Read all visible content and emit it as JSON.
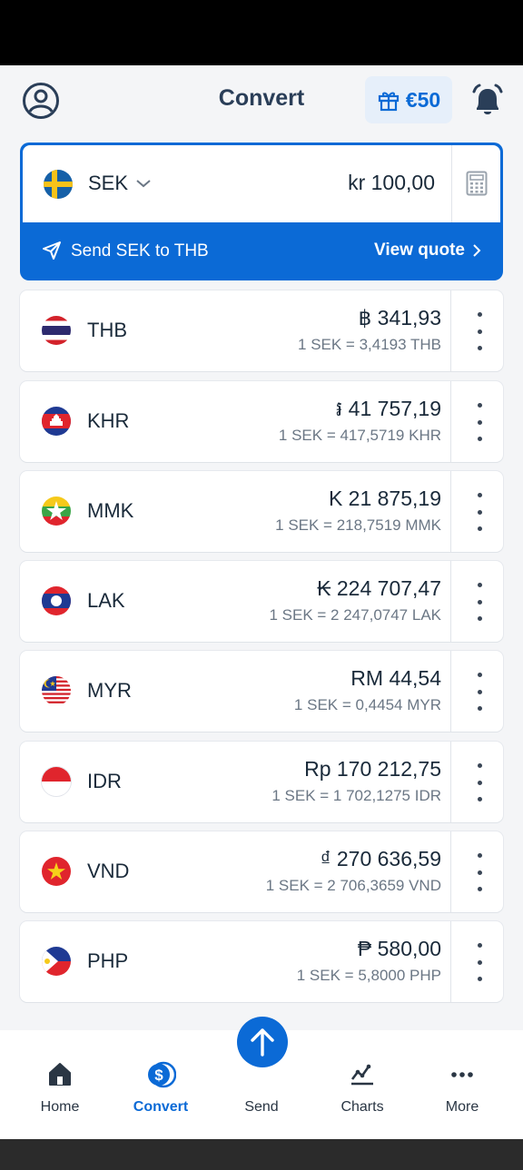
{
  "header": {
    "title": "Convert",
    "reward_label": "€50"
  },
  "base": {
    "code": "SEK",
    "amount": "kr 100,00",
    "send_label": "Send SEK to THB",
    "quote_label": "View quote"
  },
  "rows": [
    {
      "code": "THB",
      "amount": "฿ 341,93",
      "rate": "1 SEK = 3,4193 THB",
      "flag": "thailand-flag"
    },
    {
      "code": "KHR",
      "amount": "៛ 41 757,19",
      "rate": "1 SEK = 417,5719 KHR",
      "flag": "cambodia-flag"
    },
    {
      "code": "MMK",
      "amount": "K 21 875,19",
      "rate": "1 SEK = 218,7519 MMK",
      "flag": "myanmar-flag"
    },
    {
      "code": "LAK",
      "amount": "₭ 224 707,47",
      "rate": "1 SEK = 2 247,0747 LAK",
      "flag": "laos-flag"
    },
    {
      "code": "MYR",
      "amount": "RM 44,54",
      "rate": "1 SEK = 0,4454 MYR",
      "flag": "malaysia-flag"
    },
    {
      "code": "IDR",
      "amount": "Rp 170 212,75",
      "rate": "1 SEK = 1 702,1275 IDR",
      "flag": "indonesia-flag"
    },
    {
      "code": "VND",
      "amount": "₫ 270 636,59",
      "rate": "1 SEK = 2 706,3659 VND",
      "flag": "vietnam-flag"
    },
    {
      "code": "PHP",
      "amount": "₱ 580,00",
      "rate": "1 SEK = 5,8000 PHP",
      "flag": "philippines-flag"
    }
  ],
  "nav": {
    "home": "Home",
    "convert": "Convert",
    "send": "Send",
    "charts": "Charts",
    "more": "More"
  },
  "colors": {
    "accent": "#0b6ad6",
    "title": "#2a3e58"
  }
}
